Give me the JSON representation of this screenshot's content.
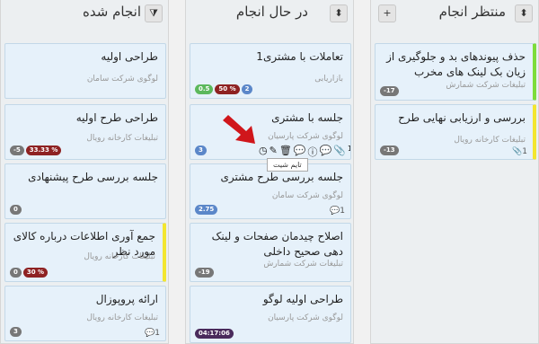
{
  "columns": {
    "waiting": {
      "title": "منتظر انجام",
      "sort_icon": "⬍",
      "add_icon": "+"
    },
    "inprogress": {
      "title": "در حال انجام",
      "sort_icon": "⬍"
    },
    "done": {
      "title": "انجام شده",
      "filter_icon": "⧩"
    }
  },
  "waiting_cards": [
    {
      "title": "حذف پیوندهای بد و جلوگیری از زیان بک لینک های مخرب",
      "sub": "تبلیغات شرکت شمارش",
      "badge": "-17",
      "bar": "green"
    },
    {
      "title": "بررسی و ارزیابی نهایی طرح",
      "sub": "تبلیغات کارخانه رویال",
      "badge": "-13",
      "attach": "1",
      "bar": "yellow"
    }
  ],
  "inprogress_cards": [
    {
      "title": "تعاملات با مشتری1",
      "sub": "بازاریابی",
      "badges": [
        "0.5",
        "50 %",
        "2"
      ]
    },
    {
      "title": "جلسه با مشتری",
      "sub": "لوگوی شرکت پارسیان",
      "badge": "3",
      "attach": "1",
      "tooltip": "تایم شیت"
    },
    {
      "title": "جلسه بررسی طرح مشتری",
      "sub": "لوگوی شرکت سامان",
      "badge": "2.75",
      "comments": "1"
    },
    {
      "title": "اصلاح چیدمان صفحات و لینک دهی صحیح داخلی",
      "sub": "تبلیغات شرکت شمارش",
      "badge": "-19"
    },
    {
      "title": "طراحی اولیه لوگو",
      "sub": "لوگوی شرکت پارسیان",
      "badge": "04:17:06"
    }
  ],
  "done_cards": [
    {
      "title": "طراحی اولیه",
      "sub": "لوگوی شرکت سامان"
    },
    {
      "title": "طراحی طرح اولیه",
      "sub": "تبلیغات کارخانه رویال",
      "badges": [
        "-5",
        "33.33 %"
      ]
    },
    {
      "title": "جلسه بررسی طرح پیشنهادی",
      "sub": "",
      "badge": "0"
    },
    {
      "title": "جمع آوری اطلاعات درباره کالای مورد نظر",
      "sub": "تبلیغات کارخانه رویال",
      "badges": [
        "0",
        "30 %"
      ],
      "bar": "yellow"
    },
    {
      "title": "ارائه پروپوزال",
      "sub": "تبلیغات کارخانه رویال",
      "badge": "3",
      "comments": "1"
    }
  ]
}
